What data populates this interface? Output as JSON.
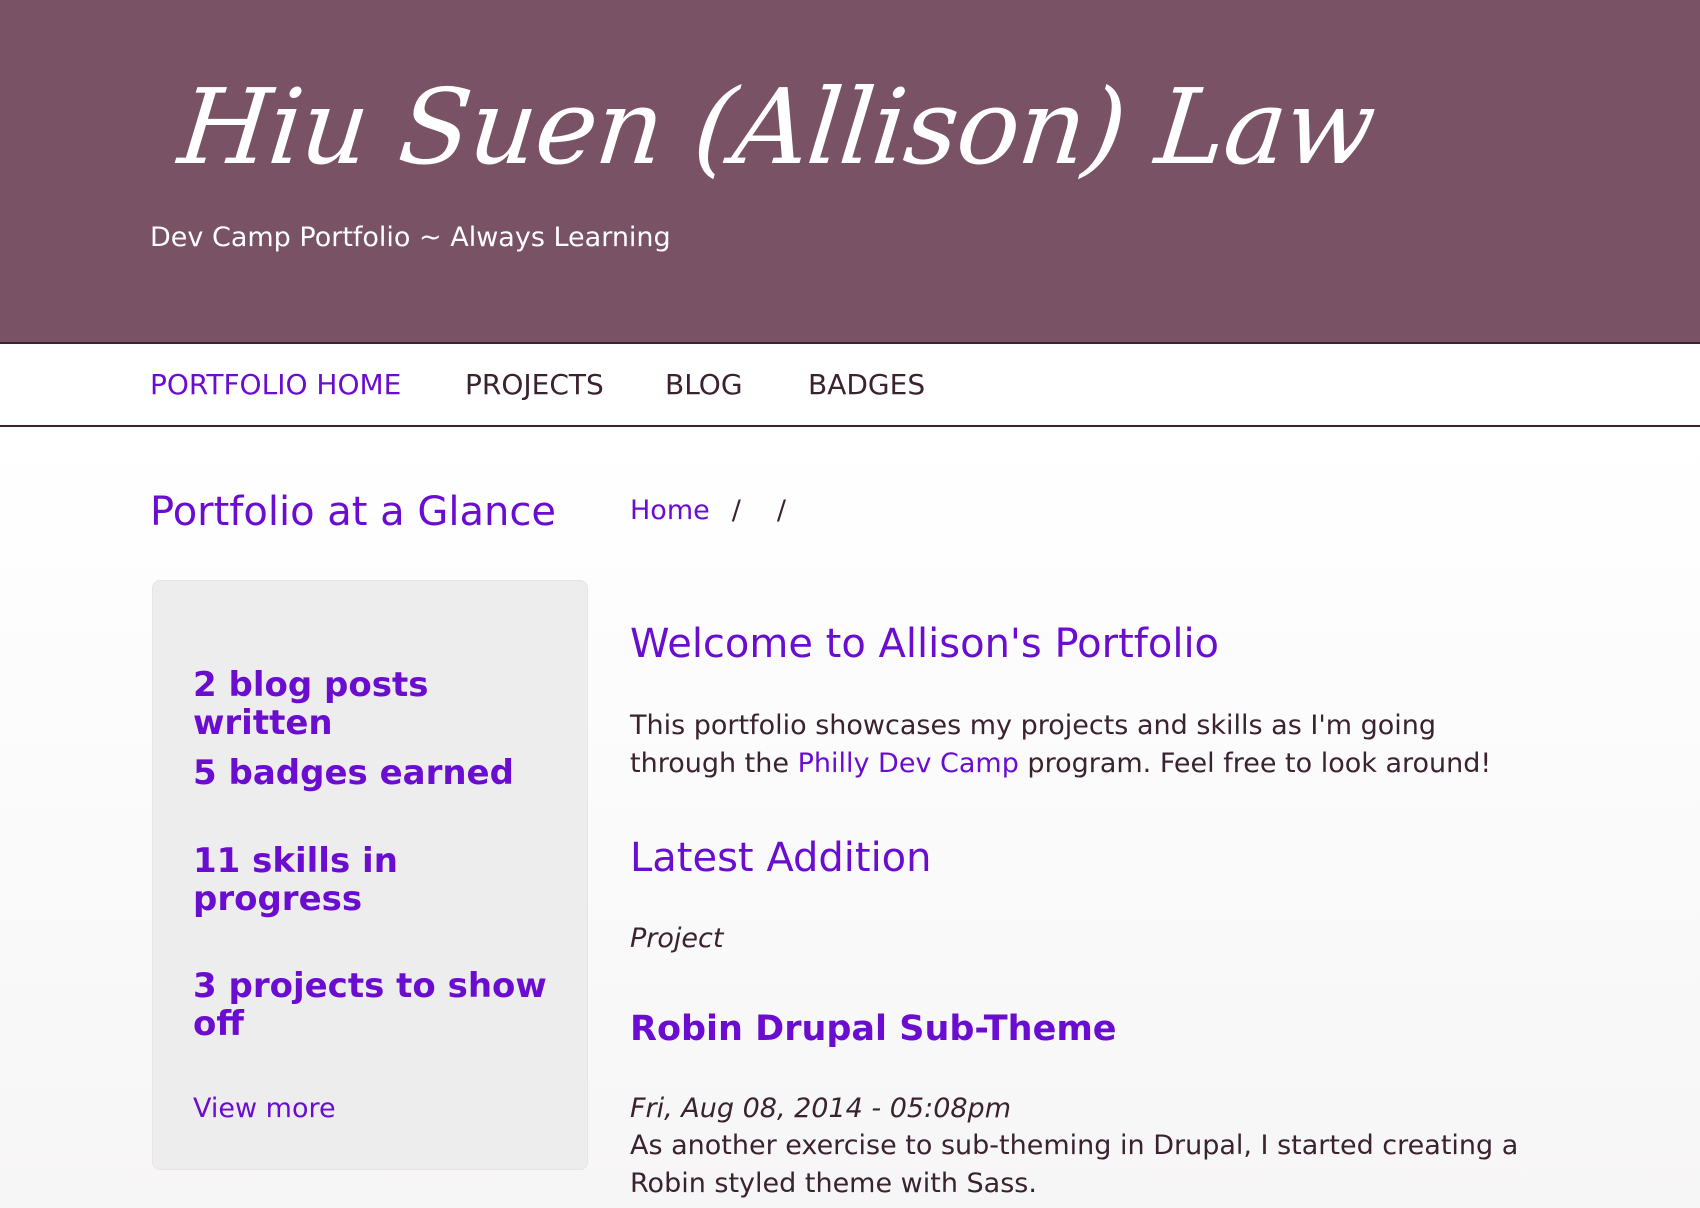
{
  "header": {
    "site_name": "Hiu Suen (Allison) Law",
    "slogan": "Dev Camp Portfolio ~ Always Learning"
  },
  "nav": {
    "items": [
      {
        "label": "PORTFOLIO HOME",
        "active": true
      },
      {
        "label": "PROJECTS",
        "active": false
      },
      {
        "label": "BLOG",
        "active": false
      },
      {
        "label": "BADGES",
        "active": false
      }
    ]
  },
  "sidebar": {
    "title": "Portfolio at a Glance",
    "stats": [
      "2 blog posts written",
      "5 badges earned",
      "11 skills in progress",
      "3 projects to show off"
    ],
    "view_more": "View more"
  },
  "breadcrumb": {
    "home": "Home",
    "separators": [
      "/",
      "/"
    ]
  },
  "main": {
    "heading": "Welcome to Allison's Portfolio",
    "intro_before": "This portfolio showcases my projects and skills as I'm going through the ",
    "intro_link": "Philly Dev Camp",
    "intro_after": " program. Feel free to look around!",
    "latest_heading": "Latest Addition",
    "latest": {
      "type": "Project",
      "title": "Robin Drupal Sub-Theme",
      "date": "Fri, Aug 08, 2014 - 05:08pm",
      "summary": "As another exercise to sub-theming in Drupal, I started creating a Robin styled theme with Sass."
    }
  },
  "colors": {
    "header_bg": "#7a5266",
    "accent": "#6b0dd0",
    "text": "#3a2230"
  }
}
